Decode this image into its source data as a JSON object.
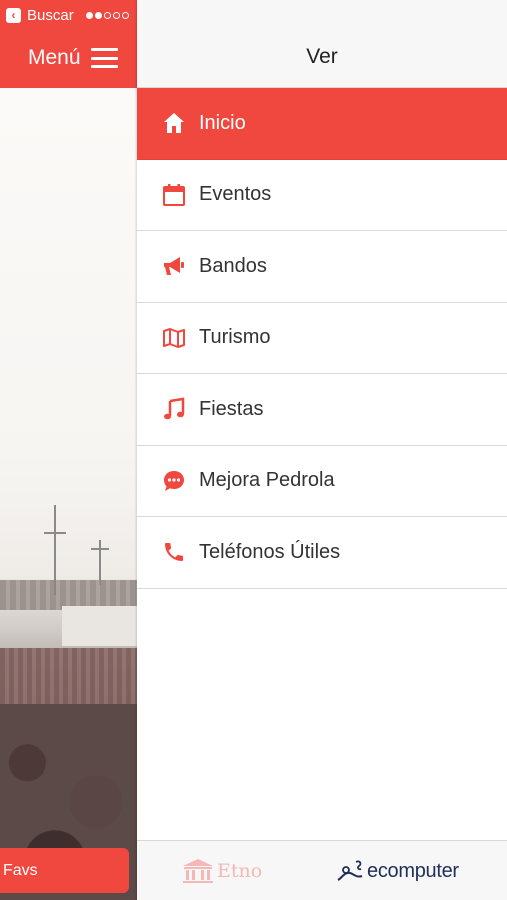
{
  "status_bar": {
    "back_label": "Buscar"
  },
  "left_screen": {
    "menu_button_label": "Menú",
    "favs_label": "Favs"
  },
  "panel": {
    "title": "Ver",
    "accent_color": "#f0483e",
    "items": [
      {
        "label": "Inicio",
        "icon": "home-icon",
        "active": true
      },
      {
        "label": "Eventos",
        "icon": "calendar-icon",
        "active": false
      },
      {
        "label": "Bandos",
        "icon": "megaphone-icon",
        "active": false
      },
      {
        "label": "Turismo",
        "icon": "map-icon",
        "active": false
      },
      {
        "label": "Fiestas",
        "icon": "music-note-icon",
        "active": false
      },
      {
        "label": "Mejora Pedrola",
        "icon": "chat-bubble-icon",
        "active": false
      },
      {
        "label": "Teléfonos Útiles",
        "icon": "phone-icon",
        "active": false
      }
    ],
    "footer": {
      "etno_label": "Etno",
      "ecomputer_label": "ecomputer"
    }
  }
}
